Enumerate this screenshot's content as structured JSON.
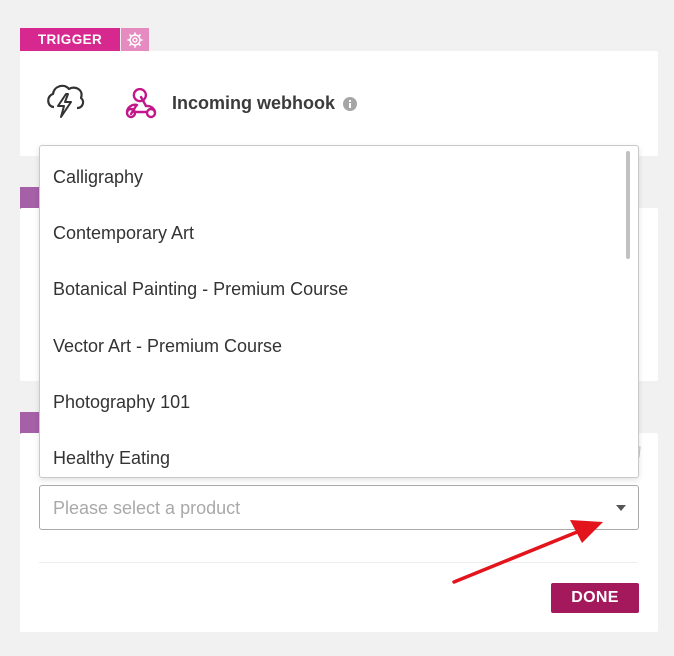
{
  "trigger": {
    "tag_label": "TRIGGER",
    "title": "Incoming webhook",
    "icons": {
      "settings": "gear-icon",
      "lightning": "lightning-icon",
      "webhook": "webhook-icon",
      "info": "info-icon"
    }
  },
  "product_dropdown": {
    "options": [
      "Calligraphy",
      "Contemporary Art",
      "Botanical Painting - Premium Course",
      "Vector Art - Premium Course",
      "Photography 101",
      "Healthy Eating"
    ],
    "placeholder": "Please select a product"
  },
  "actions": {
    "done_label": "DONE"
  },
  "colors": {
    "trigger_magenta": "#d6288f",
    "action_purple": "#a560a8",
    "done_button": "#a3195b",
    "annotation_arrow": "#e3141b"
  }
}
